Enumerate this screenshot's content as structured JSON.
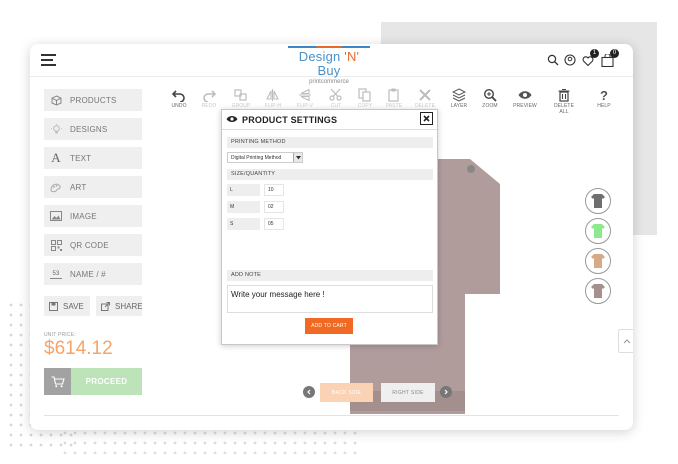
{
  "header": {
    "logo_main": "Design 'N' Buy",
    "logo_sub": "printcommerce",
    "wishlist_count": "1",
    "cart_count": "0"
  },
  "sidebar": {
    "items": [
      {
        "label": "PRODUCTS",
        "icon": "cube-icon"
      },
      {
        "label": "DESIGNS",
        "icon": "lightbulb-icon"
      },
      {
        "label": "TEXT",
        "icon": "text-a-icon"
      },
      {
        "label": "ART",
        "icon": "art-icon"
      },
      {
        "label": "IMAGE",
        "icon": "image-icon"
      },
      {
        "label": "QR CODE",
        "icon": "qr-code-icon"
      },
      {
        "label": "NAME / #",
        "icon": "name-number-icon"
      }
    ],
    "save_label": "SAVE",
    "share_label": "SHARE",
    "unit_price_label": "UNIT PRICE:",
    "price": "$614.12",
    "proceed_label": "PROCEED"
  },
  "toolbar": {
    "tools": [
      {
        "label": "UNDO",
        "icon": "undo-icon",
        "enabled": true
      },
      {
        "label": "REDO",
        "icon": "redo-icon",
        "enabled": false
      },
      {
        "label": "GROUP",
        "icon": "group-icon",
        "enabled": false
      },
      {
        "label": "FLIP-H",
        "icon": "flip-h-icon",
        "enabled": false
      },
      {
        "label": "FLIP-V",
        "icon": "flip-v-icon",
        "enabled": false
      },
      {
        "label": "CUT",
        "icon": "scissors-icon",
        "enabled": false
      },
      {
        "label": "COPY",
        "icon": "copy-icon",
        "enabled": false
      },
      {
        "label": "PASTE",
        "icon": "paste-icon",
        "enabled": false
      },
      {
        "label": "DELETE",
        "icon": "delete-x-icon",
        "enabled": false
      },
      {
        "label": "LAYER",
        "icon": "layers-icon",
        "enabled": true
      },
      {
        "label": "ZOOM",
        "icon": "zoom-icon",
        "enabled": true
      },
      {
        "label": "PREVIEW",
        "icon": "eye-icon",
        "enabled": true
      },
      {
        "label": "DELETE ALL",
        "icon": "trash-icon",
        "enabled": true
      },
      {
        "label": "HELP",
        "icon": "question-icon",
        "enabled": true
      }
    ]
  },
  "canvas": {
    "shirt_color": "#b19c9c",
    "swatches": [
      "#6f6f6f",
      "#8ee88e",
      "#d4aa88",
      "#a58f8f"
    ],
    "back_side_label": "BACK SIDE",
    "right_side_label": "RIGHT SIDE"
  },
  "modal": {
    "title": "PRODUCT SETTINGS",
    "printing_method_label": "PRINTING METHOD",
    "printing_method_value": "Digital Printing Method",
    "size_quantity_label": "SIZE/QUANTITY",
    "sizes": [
      {
        "size": "L",
        "qty": "10"
      },
      {
        "size": "M",
        "qty": "02"
      },
      {
        "size": "S",
        "qty": "05"
      }
    ],
    "add_note_label": "ADD NOTE",
    "note_text": "Write your message here !",
    "add_to_cart_label": "ADD TO CART"
  },
  "colors": {
    "accent_orange": "#f06a23",
    "price_color": "#f5a46a",
    "proceed_green": "#bde3b8"
  }
}
